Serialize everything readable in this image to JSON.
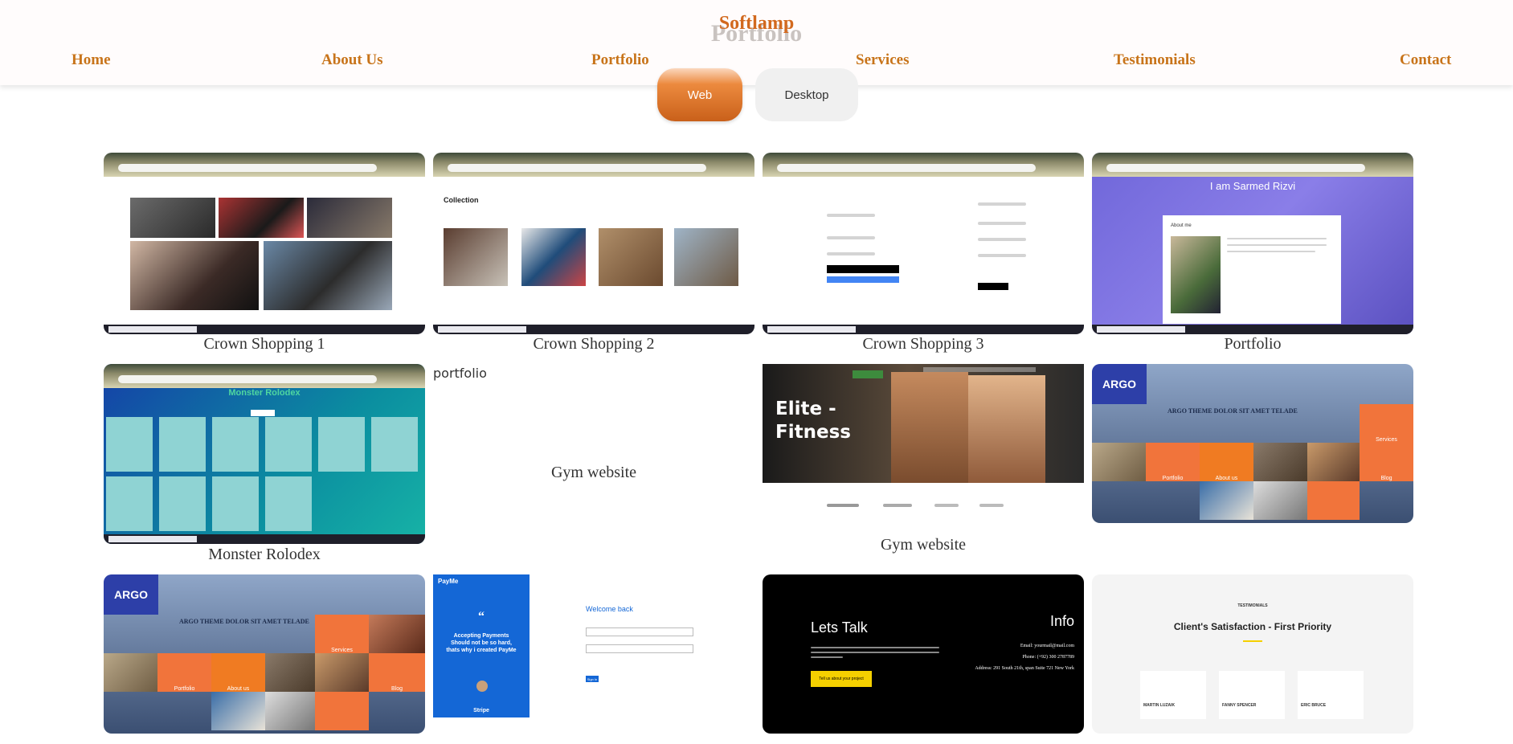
{
  "brand": "Softlamp",
  "page_title": "Portfolio",
  "nav": {
    "home": "Home",
    "about": "About Us",
    "portfolio": "Portfolio",
    "services": "Services",
    "testimonials": "Testimonials",
    "contact": "Contact"
  },
  "filters": {
    "web": "Web",
    "desktop": "Desktop"
  },
  "cards": {
    "crown1": "Crown Shopping 1",
    "crown2": "Crown Shopping 2",
    "crown3": "Crown Shopping 3",
    "portfolio": "Portfolio",
    "monster": "Monster Rolodex",
    "broken_alt": "portfolio",
    "gym_a": "Gym website",
    "gym_b": "Gym website"
  },
  "shots": {
    "crown2_heading": "Collection",
    "portfolio_hero": "I am Sarmed Rizvi",
    "portfolio_about": "About me",
    "monster_title": "Monster Rolodex",
    "gym_hero_line1": "Elite -",
    "gym_hero_line2": "Fitness",
    "argo_logo": "ARGO",
    "argo_headline": "ARGO THEME DOLOR SIT AMET TELADE",
    "argo_services": "Services",
    "argo_portfolio": "Portfolio",
    "argo_about": "About us",
    "argo_blog": "Blog",
    "payme_logo": "PayMe",
    "payme_quote": "Accepting Payments Should not be so hard, thats why i created PayMe",
    "payme_stripe": "Stripe",
    "payme_welcome": "Welcome back",
    "payme_signin": "Sign In",
    "letstalk": "Lets Talk",
    "info": "Info",
    "info_email": "Email: yourmail@mail.com",
    "info_phone": "Phone: (+92) 300 2787789",
    "info_address": "Address: 291 South 21th, span Suite 721 New York",
    "cta": "Tell us about your project",
    "testimonials_label": "TESTIMONIALS",
    "testimonials_title": "Client's Satisfaction - First Priority",
    "t1": "MARTIN LUZAIK",
    "t2": "FANNY SPENCER",
    "t3": "ERIC BRUCE"
  },
  "colors": {
    "accent": "#d2691e",
    "nav_text": "#c8741a",
    "argo_orange": "#f1743b",
    "argo_blue": "#2d3fa8"
  }
}
